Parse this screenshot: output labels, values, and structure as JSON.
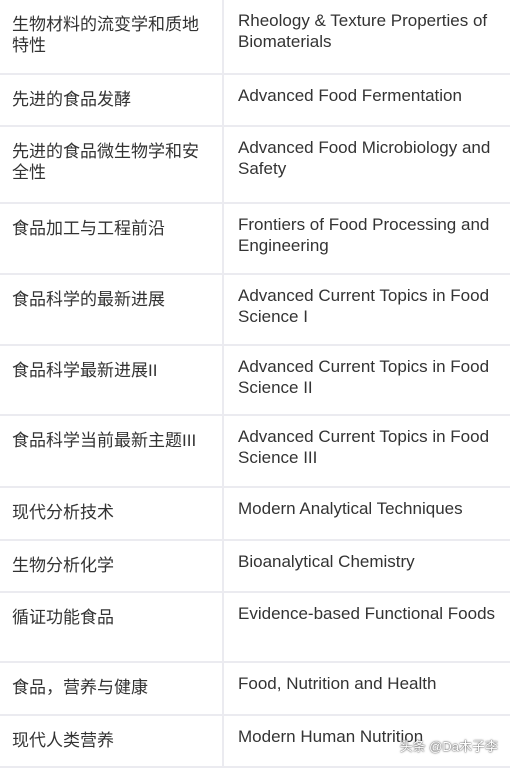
{
  "rows": [
    {
      "zh": "生物材料的流变学和质地特性",
      "en": "Rheology & Texture Properties of Biomaterials"
    },
    {
      "zh": "先进的食品发酵",
      "en": "Advanced Food Fermentation"
    },
    {
      "zh": "先进的食品微生物学和安全性",
      "en": "Advanced Food Microbiology and Safety"
    },
    {
      "zh": "食品加工与工程前沿",
      "en": "Frontiers of Food Processing and Engineering"
    },
    {
      "zh": "食品科学的最新进展",
      "en": "Advanced Current Topics in Food Science I"
    },
    {
      "zh": "食品科学最新进展II",
      "en": "Advanced Current Topics in Food Science II"
    },
    {
      "zh": "食品科学当前最新主题III",
      "en": "Advanced Current Topics in Food Science III"
    },
    {
      "zh": "现代分析技术",
      "en": "Modern Analytical Techniques"
    },
    {
      "zh": "生物分析化学",
      "en": "Bioanalytical Chemistry"
    },
    {
      "zh": "循证功能食品",
      "en": "Evidence-based Functional Foods"
    },
    {
      "zh": "食品，营养与健康",
      "en": "Food, Nutrition and Health"
    },
    {
      "zh": "现代人类营养",
      "en": "Modern Human Nutrition"
    }
  ],
  "watermark": "头条 @Da木子李"
}
